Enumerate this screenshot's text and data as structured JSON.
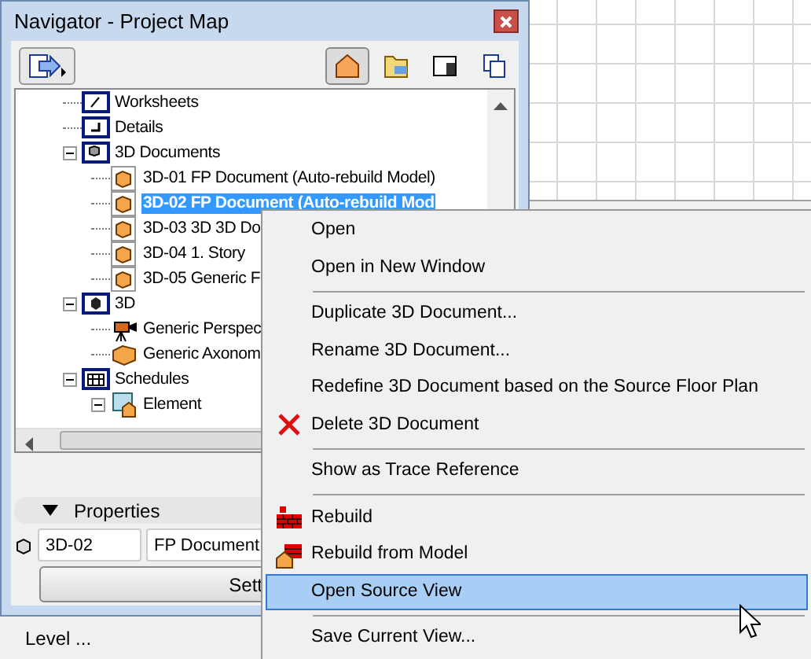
{
  "window": {
    "title": "Navigator - Project Map"
  },
  "view_tabs": [
    {
      "kind": "project",
      "selected": true
    },
    {
      "kind": "views",
      "selected": false
    },
    {
      "kind": "layouts",
      "selected": false
    },
    {
      "kind": "publisher",
      "selected": false
    }
  ],
  "tree": [
    {
      "label": "Worksheets",
      "kind": "worksheet",
      "selected": false
    },
    {
      "label": "Details",
      "kind": "detail",
      "selected": false
    },
    {
      "label": "3D Documents",
      "kind": "documents",
      "selected": false,
      "expanded": true,
      "children": [
        {
          "label": "3D-01 FP Document (Auto-rebuild Model)",
          "kind": "document",
          "selected": false
        },
        {
          "label": "3D-02 FP Document (Auto-rebuild Mod",
          "kind": "document",
          "selected": true
        },
        {
          "label": "3D-03 3D 3D Do",
          "kind": "document",
          "selected": false
        },
        {
          "label": "3D-04 1. Story",
          "kind": "document",
          "selected": false
        },
        {
          "label": "3D-05 Generic F",
          "kind": "document",
          "selected": false
        }
      ]
    },
    {
      "label": "3D",
      "kind": "cube",
      "selected": false,
      "expanded": true,
      "children": [
        {
          "label": "Generic Perspec",
          "kind": "camera",
          "selected": false
        },
        {
          "label": "Generic Axonom",
          "kind": "box",
          "selected": false
        }
      ]
    },
    {
      "label": "Schedules",
      "kind": "schedule",
      "selected": false,
      "expanded": true,
      "children": [
        {
          "label": "Element",
          "kind": "element",
          "selected": false,
          "expanded": true
        }
      ]
    }
  ],
  "properties": {
    "label": "Properties",
    "expanded": true,
    "id_value": "3D-02",
    "name_value": "FP Document",
    "button": "Sett"
  },
  "status": "Level ...",
  "context_menu": [
    {
      "kind": "item",
      "label": "Open",
      "selected": false
    },
    {
      "kind": "item",
      "label": "Open in New Window",
      "selected": false
    },
    {
      "kind": "separator"
    },
    {
      "kind": "item",
      "label": "Duplicate 3D Document...",
      "selected": false
    },
    {
      "kind": "item",
      "label": "Rename 3D Document...",
      "selected": false
    },
    {
      "kind": "item",
      "label": "Redefine 3D Document based on the Source Floor Plan",
      "selected": false
    },
    {
      "kind": "item",
      "label": "Delete 3D Document",
      "selected": false
    },
    {
      "kind": "separator"
    },
    {
      "kind": "item",
      "label": "Show as Trace Reference",
      "selected": false
    },
    {
      "kind": "separator"
    },
    {
      "kind": "item",
      "label": "Rebuild",
      "selected": false
    },
    {
      "kind": "item",
      "label": "Rebuild from Model",
      "selected": false
    },
    {
      "kind": "item",
      "label": "Open Source View",
      "selected": true
    },
    {
      "kind": "separator"
    },
    {
      "kind": "item",
      "label": "Save Current View...",
      "selected": false
    }
  ]
}
